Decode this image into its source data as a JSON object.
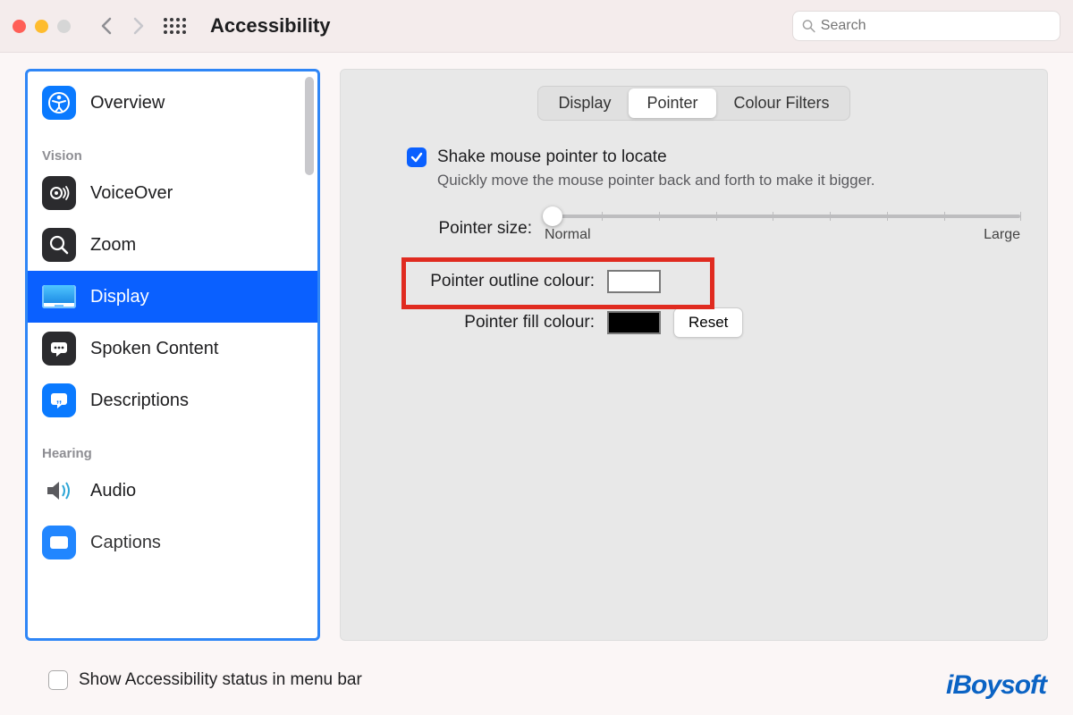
{
  "window": {
    "title": "Accessibility"
  },
  "search": {
    "placeholder": "Search"
  },
  "sidebar": {
    "overview": "Overview",
    "sections": {
      "vision": "Vision",
      "hearing": "Hearing"
    },
    "items": {
      "voiceover": "VoiceOver",
      "zoom": "Zoom",
      "display": "Display",
      "spoken": "Spoken Content",
      "descriptions": "Descriptions",
      "audio": "Audio",
      "captions": "Captions"
    }
  },
  "tabs": {
    "display": "Display",
    "pointer": "Pointer",
    "colour": "Colour Filters"
  },
  "options": {
    "shake_label": "Shake mouse pointer to locate",
    "shake_desc": "Quickly move the mouse pointer back and forth to make it bigger.",
    "pointer_size": "Pointer size:",
    "size_min": "Normal",
    "size_max": "Large",
    "outline": "Pointer outline colour:",
    "fill": "Pointer fill colour:",
    "reset": "Reset"
  },
  "footer": {
    "status_label": "Show Accessibility status in menu bar"
  },
  "watermark": "iBoysoft",
  "colors": {
    "accent": "#0a60ff",
    "highlight": "#e02b20",
    "outline_well": "#ffffff",
    "fill_well": "#000000"
  }
}
